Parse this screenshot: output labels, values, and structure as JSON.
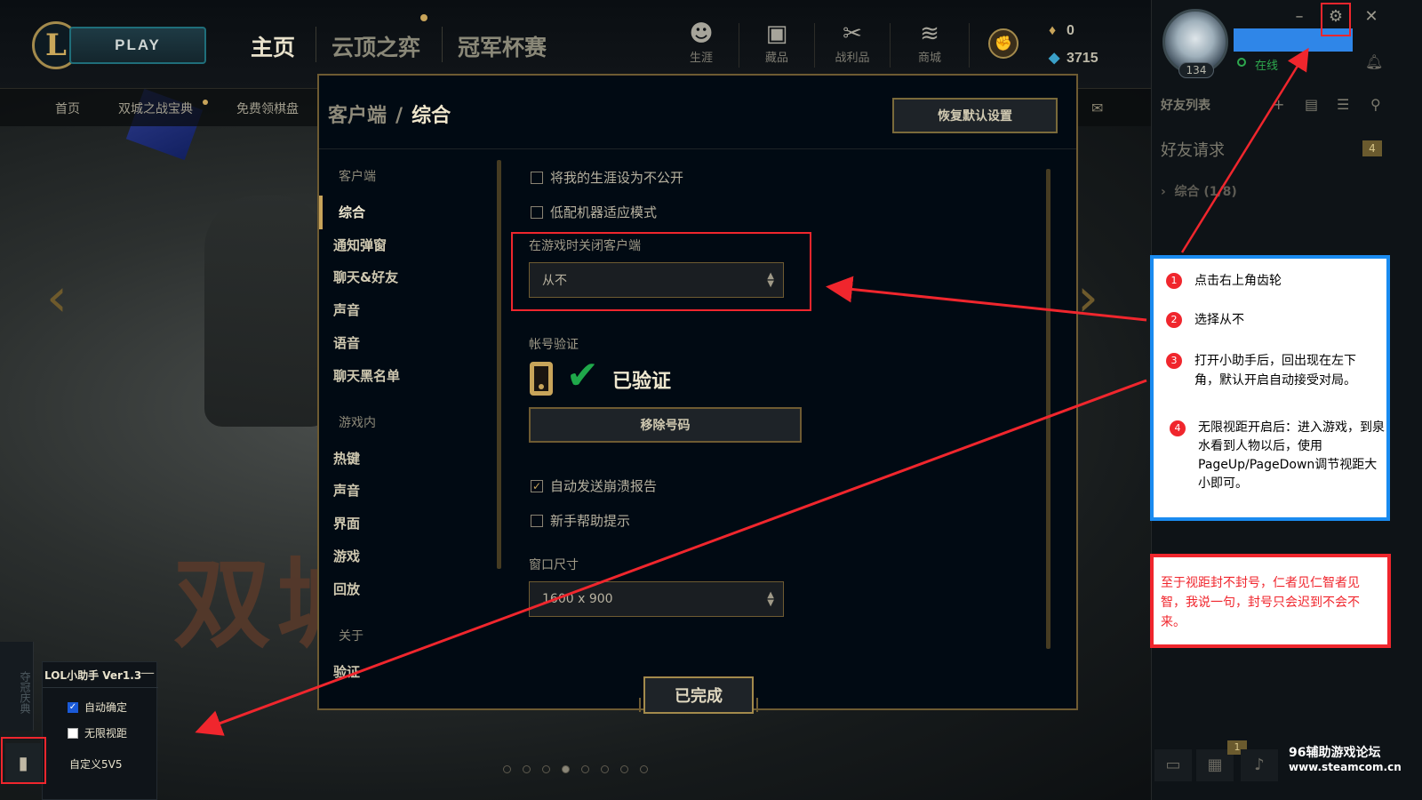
{
  "topbar": {
    "logo": "L",
    "play_label": "PLAY",
    "tabs": [
      "主页",
      "云顶之弈",
      "冠军杯赛"
    ],
    "icon_items": [
      {
        "label": "生涯",
        "icon": "person-icon"
      },
      {
        "label": "藏品",
        "icon": "chest-icon"
      },
      {
        "label": "战利品",
        "icon": "loot-icon"
      },
      {
        "label": "商城",
        "icon": "coins-icon"
      }
    ],
    "currency_rp": "0",
    "currency_be": "3715"
  },
  "subnav": [
    "首页",
    "双城之战宝典",
    "免费领棋盘"
  ],
  "background_text": "双城",
  "right_panel": {
    "level": "134",
    "status": "在线",
    "friends_header": "好友列表",
    "friend_requests": "好友请求",
    "friend_requests_count": "4",
    "group_label": "综合 (1/8)",
    "bottom_count": "1",
    "watermark_line1": "96辅助游戏论坛",
    "watermark_line2": "www.steamcom.cn"
  },
  "dialog": {
    "title_parent": "客户端",
    "title_sep": "/",
    "title_current": "综合",
    "restore_label": "恢复默认设置",
    "nav": {
      "client_head": "客户端",
      "client_items": [
        "综合",
        "通知弹窗",
        "聊天&好友",
        "声音",
        "语音",
        "聊天黑名单"
      ],
      "ingame_head": "游戏内",
      "ingame_items": [
        "热键",
        "声音",
        "界面",
        "游戏",
        "回放"
      ],
      "about_head": "关于",
      "about_items": [
        "验证"
      ]
    },
    "checkbox_private": "将我的生涯设为不公开",
    "checkbox_lowspec": "低配机器适应模式",
    "close_client_label": "在游戏时关闭客户端",
    "close_client_value": "从不",
    "account_label": "帐号验证",
    "verified_label": "已验证",
    "remove_number_label": "移除号码",
    "checkbox_crash": "自动发送崩溃报告",
    "checkbox_newbie": "新手帮助提示",
    "window_size_label": "窗口尺寸",
    "window_size_value": "1600 x 900",
    "done_label": "已完成"
  },
  "helper": {
    "side_text": "夺冠庆典",
    "title": "LOL小助手 Ver1.3",
    "minimize": "—",
    "auto_confirm": "自动确定",
    "auto_confirm_checked": true,
    "infinite_view": "无限视距",
    "infinite_view_checked": false,
    "custom_5v5": "自定义5V5"
  },
  "instructions": {
    "steps": [
      {
        "num": "1",
        "text": "点击右上角齿轮"
      },
      {
        "num": "2",
        "text": "选择从不"
      },
      {
        "num": "3",
        "text": "打开小助手后，回出现在左下角，默认开启自动接受对局。"
      },
      {
        "num": "4",
        "text": "无限视距开启后：进入游戏，到泉水看到人物以后，使用PageUp/PageDown调节视距大小即可。"
      }
    ],
    "note": "至于视距封不封号，仁者见仁智者见智，我说一句，封号只会迟到不会不来。"
  },
  "colors": {
    "gold": "#c8a45a",
    "annotation_red": "#f0262d",
    "annotation_blue": "#1a8bf0",
    "online_green": "#2ea84e"
  }
}
